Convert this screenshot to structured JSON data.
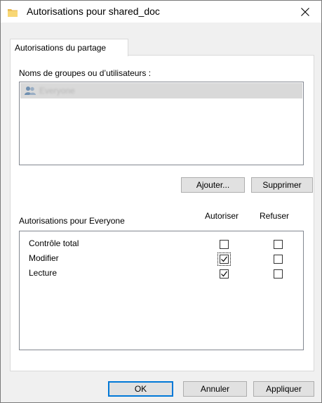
{
  "window": {
    "title": "Autorisations pour shared_doc",
    "icon": "folder-icon",
    "close_icon": "close-icon"
  },
  "tab": {
    "label": "Autorisations du partage"
  },
  "users": {
    "label": "Noms de groupes ou d’utilisateurs :",
    "items": [
      {
        "name": "Everyone",
        "icon": "users-group-icon",
        "selected": true
      }
    ]
  },
  "buttons": {
    "add": "Ajouter...",
    "remove": "Supprimer",
    "ok": "OK",
    "cancel": "Annuler",
    "apply": "Appliquer"
  },
  "permissions": {
    "header": "Autorisations pour Everyone",
    "allow_col": "Autoriser",
    "deny_col": "Refuser",
    "rows": [
      {
        "name": "Contrôle total",
        "allow": false,
        "deny": false
      },
      {
        "name": "Modifier",
        "allow": true,
        "deny": false
      },
      {
        "name": "Lecture",
        "allow": true,
        "deny": false
      }
    ]
  }
}
